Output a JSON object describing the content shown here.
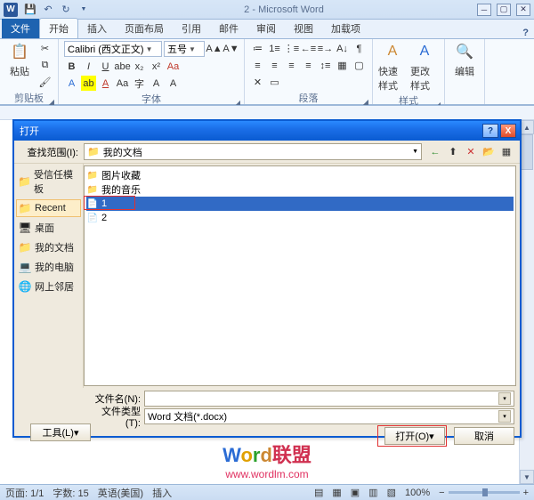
{
  "title": "2 - Microsoft Word",
  "app_icon": "W",
  "tabs": {
    "file": "文件",
    "home": "开始",
    "insert": "插入",
    "layout": "页面布局",
    "ref": "引用",
    "mail": "邮件",
    "review": "审阅",
    "view": "视图",
    "addin": "加载项"
  },
  "ribbon": {
    "clipboard": {
      "label": "剪贴板",
      "paste": "粘贴"
    },
    "font": {
      "label": "字体",
      "name": "Calibri (西文正文)",
      "size": "五号"
    },
    "paragraph": {
      "label": "段落"
    },
    "styles": {
      "label": "样式",
      "quick": "快速样式",
      "change": "更改样式"
    },
    "editing": {
      "label": "编辑"
    }
  },
  "dialog": {
    "title": "打开",
    "lookin_label": "查找范围(I):",
    "lookin_value": "我的文档",
    "places": [
      "受信任模板",
      "Recent",
      "桌面",
      "我的文档",
      "我的电脑",
      "网上邻居"
    ],
    "files": [
      "图片收藏",
      "我的音乐",
      "1",
      "2"
    ],
    "filename_label": "文件名(N):",
    "filename_value": "",
    "filetype_label": "文件类型(T):",
    "filetype_value": "Word 文档(*.docx)",
    "tools": "工具(L)",
    "open": "打开(O)",
    "cancel": "取消"
  },
  "status": {
    "page": "页面: 1/1",
    "words": "字数: 15",
    "lang": "英语(美国)",
    "mode": "插入",
    "zoom": "100%"
  },
  "watermark": {
    "brand_w": "W",
    "brand_o": "o",
    "brand_r": "r",
    "brand_d": "d",
    "brand_cn": "联盟",
    "url": "www.wordlm.com"
  }
}
